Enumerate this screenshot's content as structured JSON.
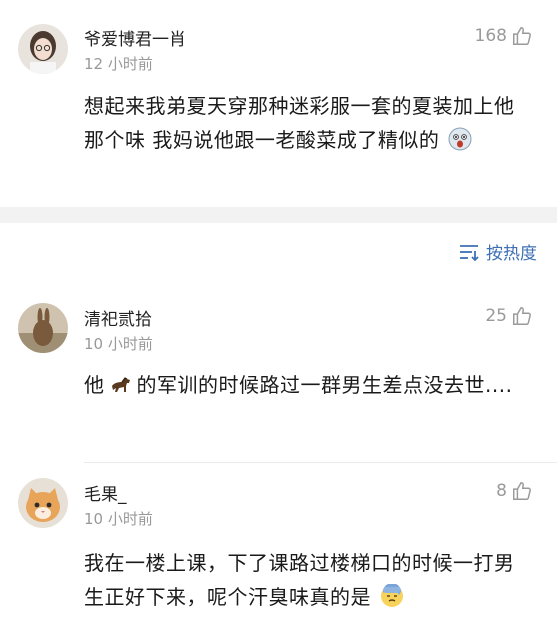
{
  "comments": [
    {
      "username": "爷爱博君一肖",
      "time": "12 小时前",
      "likes": "168",
      "text": "想起来我弟夏天穿那种迷彩服一套的夏装加上他那个味 我妈说他跟一老酸菜成了精似的"
    },
    {
      "username": "清祀贰拾",
      "time": "10 小时前",
      "likes": "25",
      "text_before": "他",
      "text_after": "的军训的时候路过一群男生差点没去世...."
    },
    {
      "username": "毛果_",
      "time": "10 小时前",
      "likes": "8",
      "text": "我在一楼上课，下了课路过楼梯口的时候一打男生正好下来，呢个汗臭味真的是"
    }
  ],
  "sort": {
    "label": "按热度"
  },
  "icons": {
    "like": "thumbs-up-icon",
    "sort": "sort-icon",
    "emoji1": "shocked-face-emoji",
    "emoji2": "horse-emoji",
    "emoji3": "cold-sweat-emoji"
  },
  "colors": {
    "accent": "#3d6fb5",
    "muted": "#999999",
    "divider": "#f2f2f2"
  }
}
